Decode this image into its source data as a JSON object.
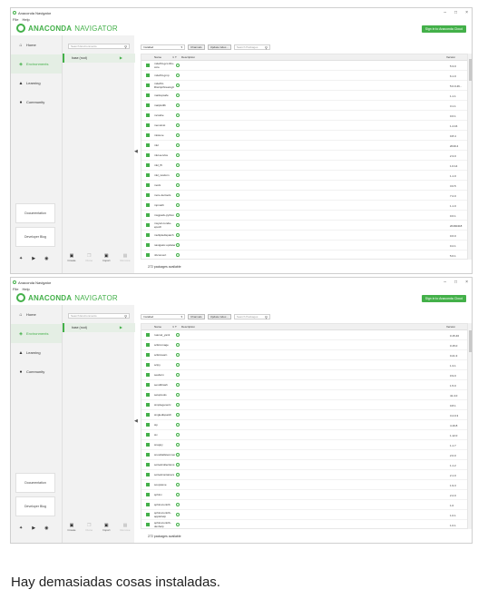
{
  "app": {
    "title": "Anaconda Navigator",
    "menus": [
      "File",
      "Help"
    ],
    "brand_bold": "ANACONDA",
    "brand_light": "NAVIGATOR",
    "signin": "Sign in to Anaconda Cloud",
    "accent": "#43b049"
  },
  "sidebar": {
    "items": [
      {
        "label": "Home",
        "icon": "home-icon"
      },
      {
        "label": "Environments",
        "icon": "cube-icon"
      },
      {
        "label": "Learning",
        "icon": "graduation-cap-icon"
      },
      {
        "label": "Community",
        "icon": "people-icon"
      }
    ],
    "documentation": "Documentation",
    "blog": "Developer Blog",
    "social": [
      "twitter-icon",
      "youtube-icon",
      "github-icon"
    ]
  },
  "environments": {
    "search_placeholder": "Search Environments",
    "items": [
      "base (root)"
    ],
    "tools": [
      "Create",
      "Clone",
      "Import",
      "Remove"
    ]
  },
  "packages": {
    "filter": "Installed",
    "channels": "Channels",
    "update_index": "Update index...",
    "search_placeholder": "Search Packages",
    "columns": {
      "name": "Name",
      "sort": "∨ T",
      "description": "Description",
      "version": "Version"
    },
    "status": "272 packages available"
  },
  "screens": [
    {
      "rows": [
        {
          "name": "m2w64-gcc-libs-core",
          "version": "5.3.0"
        },
        {
          "name": "m2w64-gmp",
          "version": "6.1.0"
        },
        {
          "name": "m2w64-libwinpthread-git",
          "version": "5.0.0.46..."
        },
        {
          "name": "markupsafe",
          "version": "1.1.1"
        },
        {
          "name": "matplotlib",
          "version": "3.1.1"
        },
        {
          "name": "mccabe",
          "version": "0.6.1"
        },
        {
          "name": "menuinst",
          "version": "1.4.16"
        },
        {
          "name": "mistune",
          "version": "0.8.4"
        },
        {
          "name": "mkl",
          "version": "2019.4"
        },
        {
          "name": "mkl-service",
          "version": "2.3.0"
        },
        {
          "name": "mkl_fft",
          "version": "1.0.14"
        },
        {
          "name": "mkl_random",
          "version": "1.1.0"
        },
        {
          "name": "mock",
          "version": "3.0.5"
        },
        {
          "name": "more-itertools",
          "version": "7.2.0"
        },
        {
          "name": "mpmath",
          "version": "1.1.0"
        },
        {
          "name": "msgpack-python",
          "version": "0.6.1"
        },
        {
          "name": "msys2-conda-epoch",
          "version": "20160418"
        },
        {
          "name": "multipledispatch",
          "version": "0.6.0"
        },
        {
          "name": "navigator-updater",
          "version": "0.2.1"
        },
        {
          "name": "nbconvert",
          "version": "5.6.1"
        }
      ]
    },
    {
      "rows": [
        {
          "name": "ruamel_yaml",
          "version": "0.15.46"
        },
        {
          "name": "scikit-image",
          "version": "0.15.0"
        },
        {
          "name": "scikit-learn",
          "version": "0.21.3"
        },
        {
          "name": "scipy",
          "version": "1.3.1"
        },
        {
          "name": "seaborn",
          "version": "0.9.0"
        },
        {
          "name": "send2trash",
          "version": "1.5.0"
        },
        {
          "name": "setuptools",
          "version": "41.4.0"
        },
        {
          "name": "simplegeneric",
          "version": "0.8.1"
        },
        {
          "name": "singledispatch",
          "version": "3.4.0.3"
        },
        {
          "name": "sip",
          "version": "4.19.8"
        },
        {
          "name": "six",
          "version": "1.12.0"
        },
        {
          "name": "snappy",
          "version": "1.1.7"
        },
        {
          "name": "snowballstemmer",
          "version": "2.0.0"
        },
        {
          "name": "sortedcollections",
          "version": "1.1.2"
        },
        {
          "name": "sortedcontainers",
          "version": "2.1.0"
        },
        {
          "name": "soupsieve",
          "version": "1.9.3"
        },
        {
          "name": "sphinx",
          "version": "2.2.0"
        },
        {
          "name": "sphinxcontrib",
          "version": "1.0"
        },
        {
          "name": "sphinxcontrib-applehelp",
          "version": "1.0.1"
        },
        {
          "name": "sphinxcontrib-devhelp",
          "version": "1.0.1"
        }
      ]
    }
  ],
  "caption": "Hay demasiadas cosas instaladas."
}
